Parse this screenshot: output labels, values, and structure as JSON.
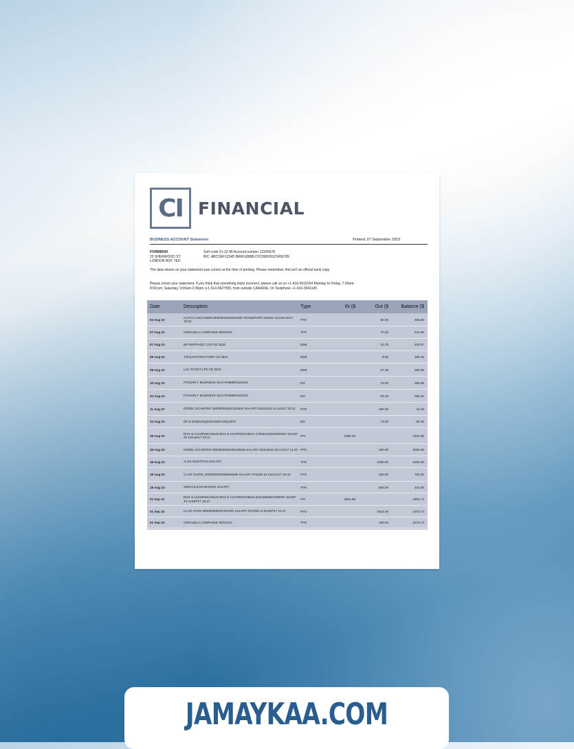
{
  "logo": {
    "mark": "CI",
    "name": "FINANCIAL"
  },
  "statement": {
    "title": "BUSINESS ACCOUNT Statement",
    "printed": "Printed: 07 September 2023",
    "address": [
      "FORMENIX",
      "20 SHERWOOD ST",
      "LONDON W1F 7ED"
    ],
    "account_line1": "Sort code 01-12-45  Account number 12345678",
    "account_line2": "BIC: ABCDEF12345   IBAN:GB88LOYD30009123456789",
    "notice1": "The data shown on your statement was correct at the time of printing. Please remember, this isn't an official bank copy.",
    "notice2": "Please check your statement. If you think that something looks incorrect, please call us on +1-416-5615294 Monday to Friday, 7:00am-8:00 pm; Saturday, 9:00am-2:00pm (+1-514-9627555, from outside CANADA). Or Textphone +1-416-3641145"
  },
  "table": {
    "headers": {
      "date": "Date",
      "description": "Description",
      "type": "Type",
      "in": "IN ($",
      "out": "Out ($",
      "balance": "Balance ($"
    },
    "rows": [
      {
        "date": "04 Aug 23",
        "description": "CUTCA ALEXANDRU5000000291504339 TRANSPORT 202541 10.04AUG17 18:22",
        "type": "FPO",
        "in": "",
        "out": "50.00",
        "balance": "455.55"
      },
      {
        "date": "07 Aug 23",
        "description": "CERASELA COMPANIE SERVICE",
        "type": "TFR",
        "in": "",
        "out": "70.00",
        "balance": "410.55"
      },
      {
        "date": "07 Aug 23",
        "description": "BP NORTHOLT LTD CD 3510",
        "type": "DEB",
        "in": "",
        "out": "10.79",
        "balance": "400.07"
      },
      {
        "date": "08 Aug 23",
        "description": "TOOLSTATION PARK CD 3510",
        "type": "DEB",
        "in": "",
        "out": "9.50",
        "balance": "395.39"
      },
      {
        "date": "08 Aug 23",
        "description": "LUL TICKET LTD CD 3510",
        "type": "DEB",
        "in": "",
        "out": "27.30",
        "balance": "355.59"
      },
      {
        "date": "10 Aug 23",
        "description": "PCISUPLY BUSINESS 34ACFN6890/010/103",
        "type": "DD",
        "in": "",
        "out": "10.00",
        "balance": "355.59"
      },
      {
        "date": "10 Aug 23",
        "description": "PCISUPLY BUSINESS 34ACFN6890/010/104",
        "type": "DD",
        "in": "",
        "out": "63.39",
        "balance": "295.20"
      },
      {
        "date": "11 Aug 23",
        "description": "DOREL SCHINTEE 300000000297332504 SALARY 52314818 11 AUG17 20:11",
        "type": "FPO",
        "in": "",
        "out": "280.00",
        "balance": "15.20"
      },
      {
        "date": "14 Aug 23",
        "description": "EE & MOBILEQ03310349744013870",
        "type": "DD",
        "in": "",
        "out": "73.50",
        "balance": "-58.30"
      },
      {
        "date": "18 Aug 23",
        "description": "BOX & CHARNOCKBUS BOX & CHARNOCKBUS 470534112010940OR 161307 40 18AUG17 03:11",
        "type": "FPI",
        "in": "2380.36",
        "out": "",
        "balance": "2322.06"
      },
      {
        "date": "18 Aug 23",
        "description": "DOREL SCHINTEE 5000000002346145528 SALARY 52314819 18 AUG17 11:23",
        "type": "FPO",
        "in": "",
        "out": "320.00",
        "balance": "2002.06"
      },
      {
        "date": "18 Aug 23",
        "description": "ALEX MUNTEAN SALARY",
        "type": "TFR",
        "in": "",
        "out": "1000.00",
        "balance": "1002.06"
      },
      {
        "date": "18 Aug 23",
        "description": "CLAR OVIDIU 4000000002966654566 SALARY 070436 10 18AUG17 16:42",
        "type": "FPO",
        "in": "",
        "out": "300.00",
        "balance": "702.06"
      },
      {
        "date": "18 Aug 23",
        "description": "SERCULEAN MARIUS SALARY",
        "type": "TFR",
        "in": "",
        "out": "600.00",
        "balance": "102.06"
      },
      {
        "date": "01 Sep 23",
        "description": "BOX & CHARNOCKBUS BOX & CHARNOCKBUS 51012894827090OR 161307 40 01SEP17 10:27",
        "type": "FPI",
        "in": "4802.68",
        "out": "",
        "balance": "4904.74"
      },
      {
        "date": "01 Sep 23",
        "description": "CLAR OVIDI 500000000297337622 SALARY 070436 10 01SEP17 11:37",
        "type": "FPO",
        "in": "",
        "out": "2534.00",
        "balance": "2370.74"
      },
      {
        "date": "01 Sep 23",
        "description": "CERASELA COMPANIE SERVICE",
        "type": "TFR",
        "in": "",
        "out": "100.00",
        "balance": "2270.74"
      }
    ]
  },
  "banner": {
    "text": "JAMAYKAA.COM"
  }
}
